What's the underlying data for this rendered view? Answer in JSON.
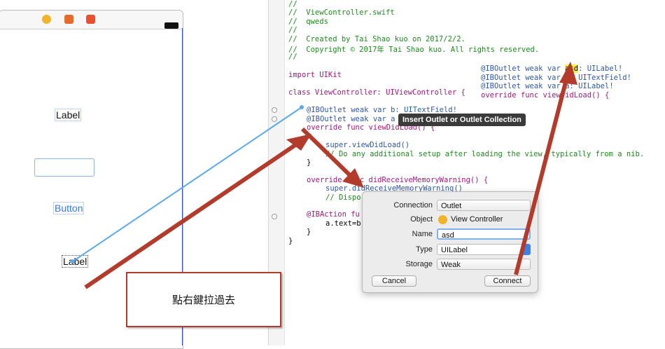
{
  "canvas": {
    "scene_labels": {
      "label_top": "Label",
      "button": "Button",
      "label_selected": "Label"
    },
    "text_field_value": ""
  },
  "code": {
    "header": [
      "//",
      "//  ViewController.swift",
      "//  qweds",
      "//",
      "//  Created by Tai Shao kuo on 2017/2/2.",
      "//  Copyright © 2017年 Tai Shao kuo. All rights reserved.",
      "//"
    ],
    "import_line": "import UIKit",
    "class_line": "class ViewController: UIViewController {",
    "outlet_b": "@IBOutlet weak var b: UITextField!",
    "outlet_a": "@IBOutlet weak var a",
    "override_load": "override func viewDidLoad() {",
    "super_load": "super.viewDidLoad()",
    "comment_setup": "// Do any additional setup after loading the view, typically from a nib.",
    "close1": "}",
    "override_memory": "override func didReceiveMemoryWarning() {",
    "super_memory": "super.didReceiveMemoryWarning()",
    "comment_dispose": "// Dispo",
    "action": "@IBAction fu",
    "assign": "a.text=b",
    "close2": "}",
    "close3": "}"
  },
  "preview": {
    "line1_prefix": "@IBOutlet weak var ",
    "line1_name": "asd",
    "line1_suffix": ": UILabel!",
    "line2": "@IBOutlet weak var b: UITextField!",
    "line3": "@IBOutlet weak var a: UILabel!",
    "line4": "override func viewDidLoad() {"
  },
  "tooltip": "Insert Outlet or Outlet Collection",
  "popover": {
    "connection_label": "Connection",
    "connection_value": "Outlet",
    "object_label": "Object",
    "object_value": "View Controller",
    "name_label": "Name",
    "name_value": "asd",
    "type_label": "Type",
    "type_value": "UILabel",
    "storage_label": "Storage",
    "storage_value": "Weak",
    "cancel": "Cancel",
    "connect": "Connect"
  },
  "annotation": {
    "text": "點右鍵拉過去",
    "arrow_color": "#b23b2c"
  },
  "colors": {
    "comment": "#1d8a1d",
    "keyword": "#a2197d",
    "type": "#2f58a8",
    "highlight": "#f7f047",
    "connection_line": "#5aa9ec"
  }
}
